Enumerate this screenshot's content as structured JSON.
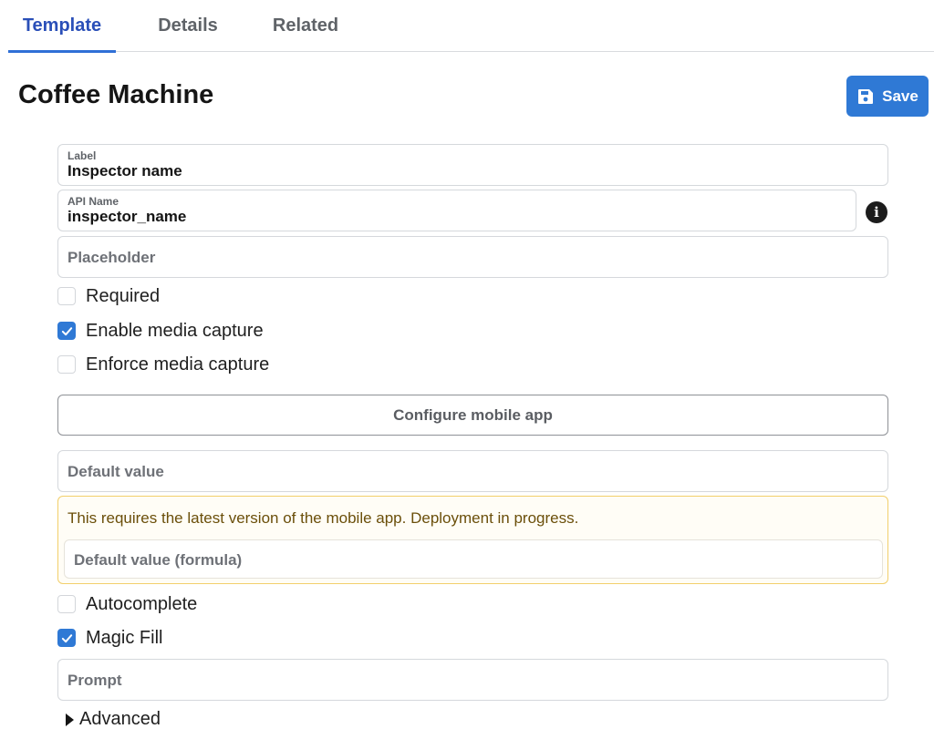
{
  "tabs": [
    {
      "label": "Template",
      "active": true
    },
    {
      "label": "Details",
      "active": false
    },
    {
      "label": "Related",
      "active": false
    }
  ],
  "header": {
    "title": "Coffee Machine",
    "save_label": "Save"
  },
  "form": {
    "label_field": {
      "label": "Label",
      "value": "Inspector name"
    },
    "api_field": {
      "label": "API Name",
      "value": "inspector_name"
    },
    "placeholder_field": {
      "placeholder": "Placeholder"
    },
    "checkboxes_top": [
      {
        "label": "Required",
        "checked": false
      },
      {
        "label": "Enable media capture",
        "checked": true
      },
      {
        "label": "Enforce media capture",
        "checked": false
      }
    ],
    "configure_button_label": "Configure mobile app",
    "default_value_field": {
      "placeholder": "Default value"
    },
    "warning": {
      "text": "This requires the latest version of the mobile app. Deployment in progress.",
      "formula_placeholder": "Default value (formula)"
    },
    "checkboxes_bottom": [
      {
        "label": "Autocomplete",
        "checked": false
      },
      {
        "label": "Magic Fill",
        "checked": true
      }
    ],
    "prompt_field": {
      "placeholder": "Prompt"
    },
    "advanced_label": "Advanced"
  },
  "colors": {
    "accent": "#2f79d5",
    "active_tab": "#2a4fb8",
    "warning_border": "#f2cf6b",
    "warning_text": "#6b4f0a"
  },
  "icons": [
    "save-icon",
    "info-icon",
    "checkmark-icon",
    "caret-right-icon"
  ]
}
